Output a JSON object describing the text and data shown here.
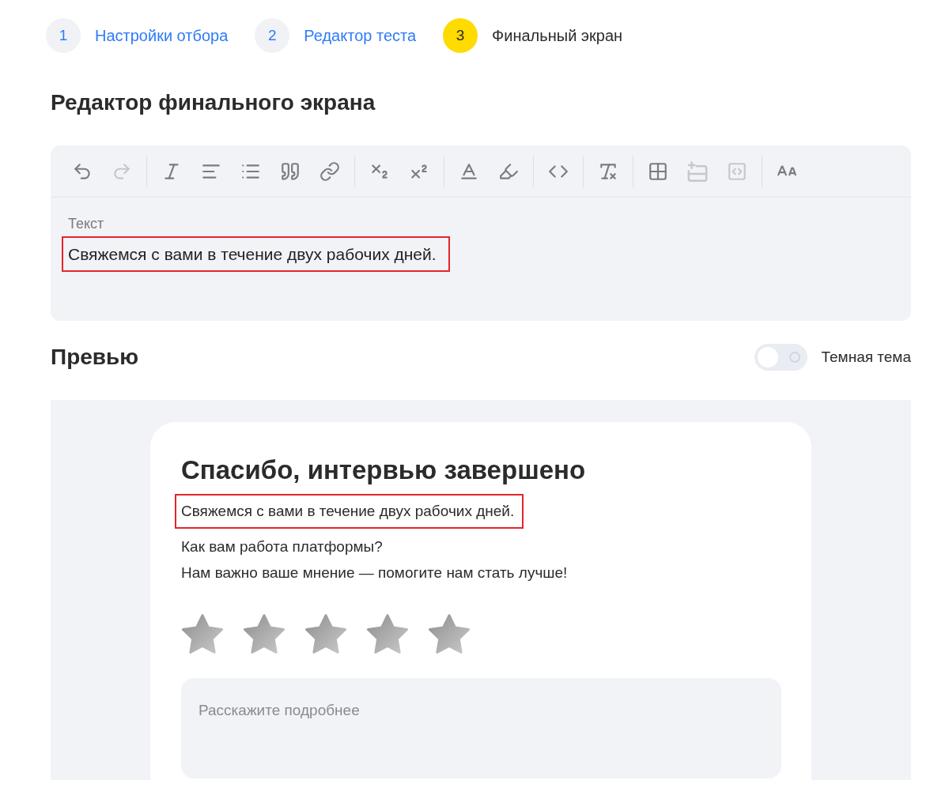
{
  "stepper": [
    {
      "number": "1",
      "label": "Настройки отбора",
      "selected": false
    },
    {
      "number": "2",
      "label": "Редактор теста",
      "selected": false
    },
    {
      "number": "3",
      "label": "Финальный экран",
      "selected": true
    }
  ],
  "editor": {
    "title": "Редактор финального экрана",
    "toolbar": [
      {
        "items": [
          {
            "kind": "undo",
            "disabled": false
          },
          {
            "kind": "redo",
            "disabled": true
          }
        ]
      },
      {
        "items": [
          {
            "kind": "font",
            "disabled": false
          },
          {
            "kind": "align",
            "disabled": false
          },
          {
            "kind": "list",
            "disabled": false
          },
          {
            "kind": "quote",
            "disabled": false
          },
          {
            "kind": "link",
            "disabled": false
          }
        ]
      },
      {
        "items": [
          {
            "kind": "subscript",
            "disabled": false
          },
          {
            "kind": "superscript",
            "disabled": false
          }
        ]
      },
      {
        "items": [
          {
            "kind": "color",
            "disabled": false
          },
          {
            "kind": "highlight",
            "disabled": false
          }
        ]
      },
      {
        "items": [
          {
            "kind": "code",
            "disabled": false
          }
        ]
      },
      {
        "items": [
          {
            "kind": "clear",
            "disabled": false
          }
        ]
      },
      {
        "items": [
          {
            "kind": "table",
            "disabled": false
          },
          {
            "kind": "row",
            "disabled": true
          },
          {
            "kind": "embed",
            "disabled": true
          }
        ]
      },
      {
        "items": [
          {
            "kind": "size",
            "disabled": false
          }
        ]
      }
    ],
    "field": {
      "label": "Текст",
      "value": "Свяжемся с вами в течение двух рабочих дней.",
      "highlighted": true
    }
  },
  "preview": {
    "title": "Превью",
    "dark_theme": {
      "label": "Темная тема",
      "on": false
    },
    "card": {
      "title": "Спасибо, интервью завершено",
      "lines": [
        {
          "text": "Свяжемся с вами в течение двух рабочих дней.",
          "highlighted": true
        },
        {
          "text": "Как вам работа платформы?",
          "highlighted": false
        },
        {
          "text": "Нам важно ваше мнение — помогите нам стать лучше!",
          "highlighted": false
        }
      ],
      "rating": {
        "stars": 0
      },
      "comment": {
        "placeholder": "Расскажите подробнее"
      }
    }
  }
}
